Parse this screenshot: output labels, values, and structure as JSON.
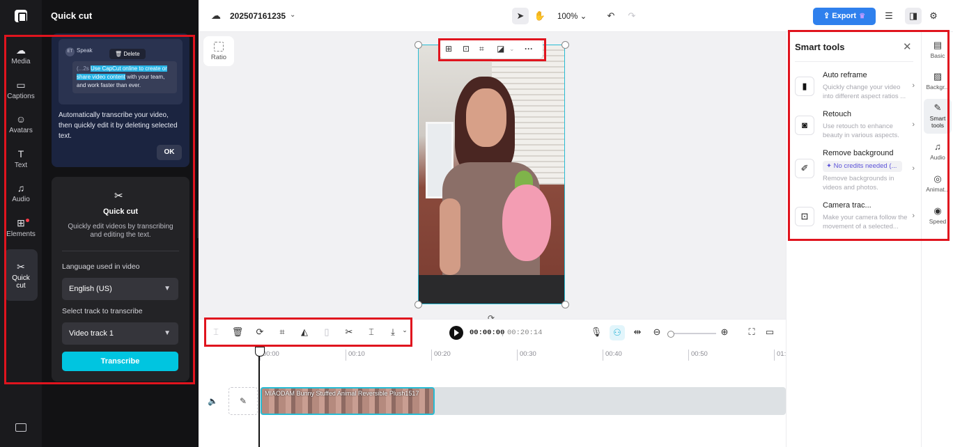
{
  "rail": {
    "items": [
      {
        "icon": "☁",
        "label": "Media"
      },
      {
        "icon": "▭",
        "label": "Captions"
      },
      {
        "icon": "☺",
        "label": "Avatars"
      },
      {
        "icon": "T",
        "label": "Text"
      },
      {
        "icon": "♫",
        "label": "Audio"
      },
      {
        "icon": "⊞",
        "label": "Elements"
      },
      {
        "icon": "✂",
        "label": "Quick cut"
      }
    ]
  },
  "left_panel": {
    "title": "Quick cut",
    "tip": {
      "speaker": "Speak",
      "speaker_avatar": "ET",
      "delete_label": "Delete",
      "sample_prefix": "(...2s",
      "sample_highlight": "Use CapCut online to create or share video content",
      "sample_rest": "with your team, and work faster than ever.",
      "description": "Automatically transcribe your video, then quickly edit it by deleting selected text.",
      "ok_label": "OK"
    },
    "quick_cut": {
      "title": "Quick cut",
      "description": "Quickly edit videos by transcribing and editing the text.",
      "language_label": "Language used in video",
      "language_value": "English (US)",
      "track_label": "Select track to transcribe",
      "track_value": "Video track 1",
      "transcribe_label": "Transcribe"
    }
  },
  "topbar": {
    "project_name": "202507161235",
    "zoom": "100%",
    "export_label": "Export"
  },
  "canvas": {
    "ratio_label": "Ratio"
  },
  "timeline": {
    "current_time": "00:00:00",
    "separator": "|",
    "total_time": "00:20:14",
    "ruler": [
      "00:00",
      "00:10",
      "00:20",
      "00:30",
      "00:40",
      "00:50",
      "01:"
    ],
    "clip_name": "MIAODAM Bunny Stuffed Animal Reversible Plush1517"
  },
  "smart_tools": {
    "title": "Smart tools",
    "tools": [
      {
        "name": "Auto reframe",
        "desc": "Quickly change your video into different aspect ratios ..."
      },
      {
        "name": "Retouch",
        "desc": "Use retouch to enhance beauty in various aspects."
      },
      {
        "name": "Remove background",
        "credits": "No credits needed (...",
        "desc": "Remove backgrounds in videos and photos."
      },
      {
        "name": "Camera trac...",
        "desc": "Make your camera follow the movement of a selected..."
      }
    ]
  },
  "right_rail": {
    "items": [
      {
        "icon": "▤",
        "label": "Basic"
      },
      {
        "icon": "▨",
        "label": "Backgr..."
      },
      {
        "icon": "✎",
        "label": "Smart tools"
      },
      {
        "icon": "♫",
        "label": "Audio"
      },
      {
        "icon": "◎",
        "label": "Animat..."
      },
      {
        "icon": "◉",
        "label": "Speed"
      }
    ]
  },
  "colors": {
    "accent": "#00c5e0",
    "export": "#2f80ed",
    "annotation": "#e0141e"
  }
}
